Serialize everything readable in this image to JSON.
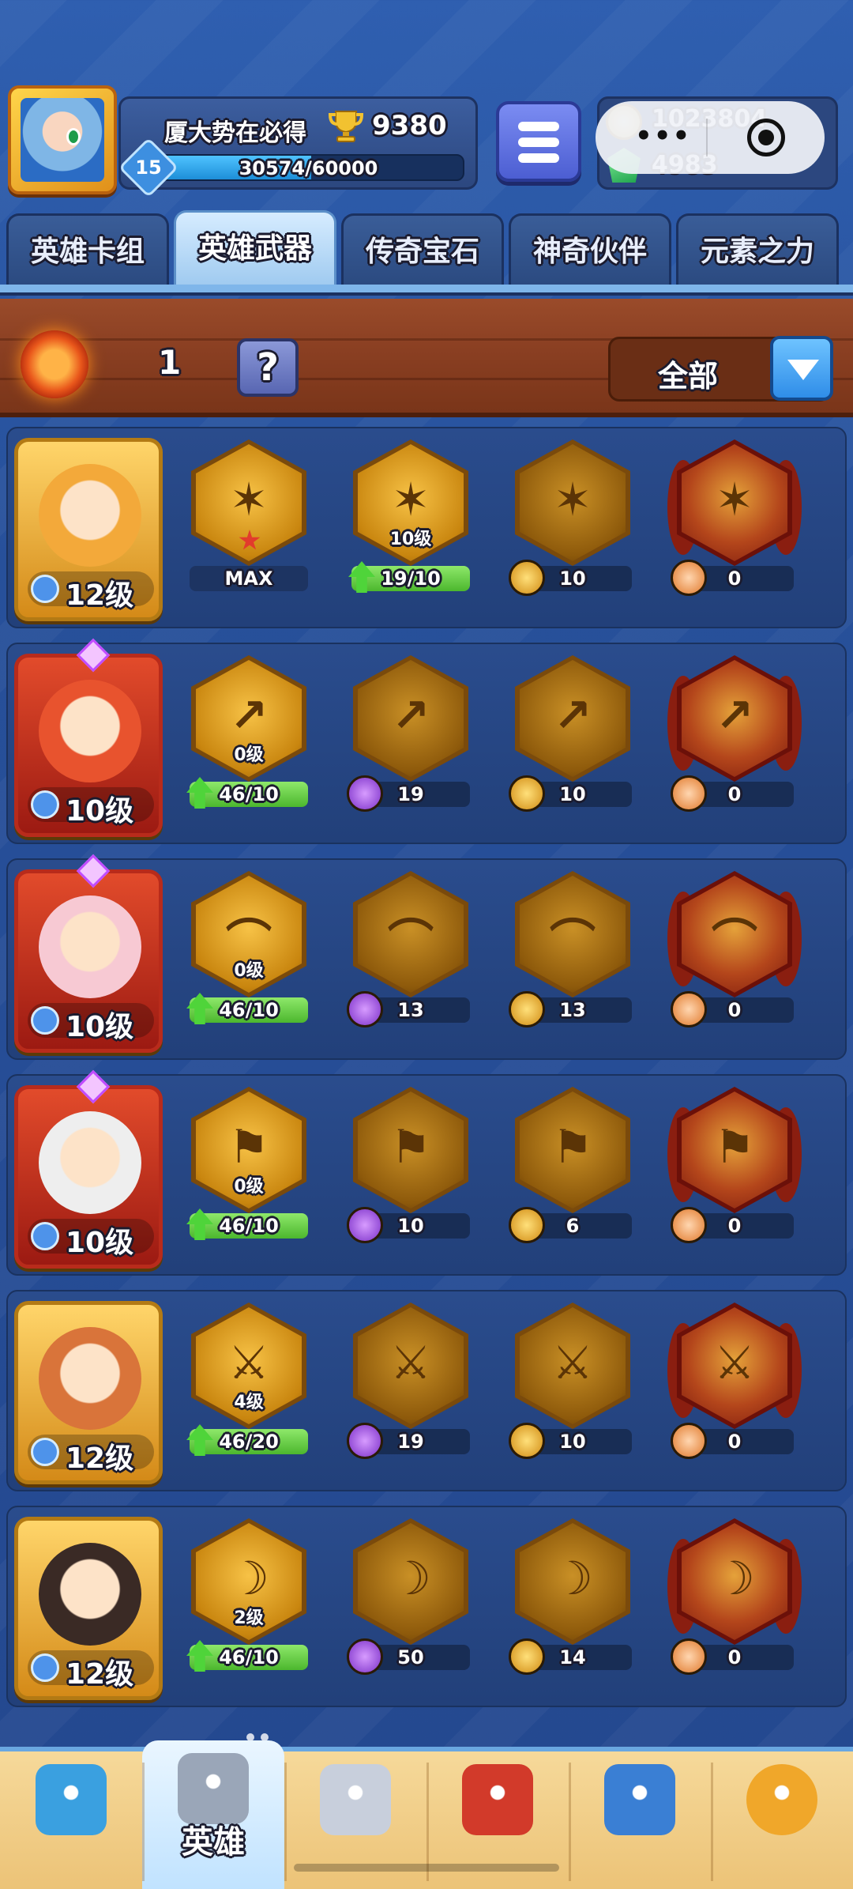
{
  "header": {
    "player_name": "厦大势在必得",
    "trophies": "9380",
    "player_level": "15",
    "xp_text": "30574/60000",
    "xp_progress": 0.51,
    "coins": "1023804",
    "gems": "4983",
    "capsule_dots": "•••"
  },
  "tabs": [
    {
      "label": "英雄卡组",
      "active": false
    },
    {
      "label": "英雄武器",
      "active": true
    },
    {
      "label": "传奇宝石",
      "active": false
    },
    {
      "label": "神奇伙伴",
      "active": false
    },
    {
      "label": "元素之力",
      "active": false
    }
  ],
  "toolbar": {
    "resource_count": "1",
    "help_label": "?",
    "filter_label": "全部"
  },
  "heroes": [
    {
      "level": "12级",
      "frame": "gold",
      "slots": [
        {
          "level": "",
          "bar": "MAX",
          "bar_style": "max",
          "star": true,
          "glyph": "✶"
        },
        {
          "level": "10级",
          "bar": "19/10",
          "bar_style": "green",
          "glyph": "✶"
        },
        {
          "bar": "10",
          "icon": "gold",
          "glyph": "✶"
        },
        {
          "bar": "0",
          "icon": "face",
          "glyph": "✶",
          "red": true
        }
      ]
    },
    {
      "level": "10级",
      "frame": "red",
      "slots": [
        {
          "level": "0级",
          "bar": "46/10",
          "bar_style": "green",
          "glyph": "↗"
        },
        {
          "bar": "19",
          "icon": "purple",
          "glyph": "↗"
        },
        {
          "bar": "10",
          "icon": "gold",
          "glyph": "↗"
        },
        {
          "bar": "0",
          "icon": "face",
          "glyph": "↗",
          "red": true
        }
      ]
    },
    {
      "level": "10级",
      "frame": "red",
      "slots": [
        {
          "level": "0级",
          "bar": "46/10",
          "bar_style": "green",
          "glyph": "⌒"
        },
        {
          "bar": "13",
          "icon": "purple",
          "glyph": "⌒"
        },
        {
          "bar": "13",
          "icon": "gold",
          "glyph": "⌒"
        },
        {
          "bar": "0",
          "icon": "face",
          "glyph": "⌒",
          "red": true
        }
      ]
    },
    {
      "level": "10级",
      "frame": "red",
      "slots": [
        {
          "level": "0级",
          "bar": "46/10",
          "bar_style": "green",
          "glyph": "⚑"
        },
        {
          "bar": "10",
          "icon": "purple",
          "glyph": "⚑"
        },
        {
          "bar": "6",
          "icon": "gold",
          "glyph": "⚑"
        },
        {
          "bar": "0",
          "icon": "face",
          "glyph": "⚑",
          "red": true
        }
      ]
    },
    {
      "level": "12级",
      "frame": "gold",
      "slots": [
        {
          "level": "4级",
          "bar": "46/20",
          "bar_style": "green",
          "glyph": "⚔"
        },
        {
          "bar": "19",
          "icon": "purple",
          "glyph": "⚔"
        },
        {
          "bar": "10",
          "icon": "gold",
          "glyph": "⚔"
        },
        {
          "bar": "0",
          "icon": "face",
          "glyph": "⚔",
          "red": true
        }
      ]
    },
    {
      "level": "12级",
      "frame": "gold",
      "slots": [
        {
          "level": "2级",
          "bar": "46/10",
          "bar_style": "green",
          "glyph": "☽"
        },
        {
          "bar": "50",
          "icon": "purple",
          "glyph": "☽"
        },
        {
          "bar": "14",
          "icon": "gold",
          "glyph": "☽"
        },
        {
          "bar": "0",
          "icon": "face",
          "glyph": "☽",
          "red": true
        }
      ]
    }
  ],
  "bottom_nav": [
    {
      "label": "",
      "icon": "treasure-chest-icon"
    },
    {
      "label": "英雄",
      "icon": "knight-helmet-icon",
      "active": true
    },
    {
      "label": "",
      "icon": "crossed-swords-icon"
    },
    {
      "label": "",
      "icon": "crown-shield-icon"
    },
    {
      "label": "",
      "icon": "guild-members-icon"
    },
    {
      "label": "",
      "icon": "compass-icon"
    }
  ],
  "colors": {
    "background": "#2a52a0",
    "wood": "#8a3f22",
    "accent_blue": "#2f8de8",
    "progress_green": "#4cb72e"
  }
}
